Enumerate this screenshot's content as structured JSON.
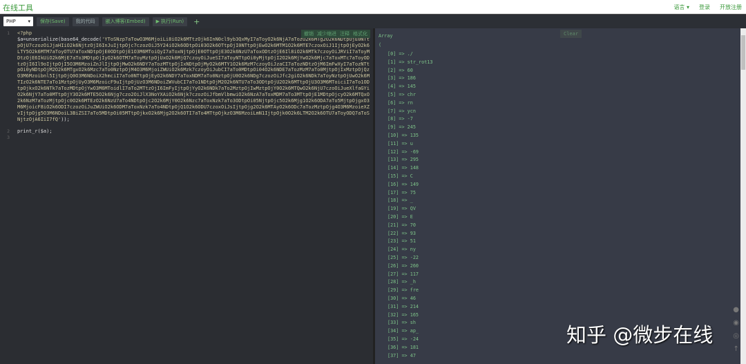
{
  "header": {
    "brand": "在线工具",
    "nav": [
      "语言 ▾",
      "登录",
      "开放注册"
    ]
  },
  "toolbar": {
    "language": "PHP",
    "save": "保存(Save)",
    "my_code": "我的代码",
    "embed": "嵌入博客(Embed)",
    "run": "▶ 执行(Run)",
    "add": "+"
  },
  "editor": {
    "tools": [
      "撤销",
      "减少缩进",
      "注释",
      "格式化"
    ],
    "line_numbers": [
      "1",
      "2",
      "3"
    ],
    "line1": "<?php",
    "code_prefix": "$a=unserialize(base64_decode(",
    "base64": "'YToSNzp7aTowO3M6MjoiLi8iO2k6MTtzOjk6InN0cl9yb3QxMyI7aToyO2k6NjA7aTozO2k6MTg2O2k6NDtpOjE0NTtpOjU7czozOiJjaHIiO2k6NjtzOjI6InJuIjtpOjc7czozOiJ5Y24iO2k6ODtpOi03O2k6OTtpOjI0NTtpOjEwO2k6MTM1O2k6MTE7czoxOiJ1IjtpOjEyO2k6LTY5O2k6MTM7aToyOTU7aToxNDtpOjE0ODtpOjE1O3M6MToiQyI7aToxNjtpOjE0OTtpOjE3O2k6NzU7aToxODtzOjE6Il8iO2k6MTk7czoyOiJRViI7aToyMDtzOjE6IkUiO2k6MjE7aTo3MDtpOjIyO2k6OTM7aToyMztpOjUxO2k6MjQ7czoyOiJueSI7aToyNTtpOi0yMjtpOjI2O2k6MjYwO2k6Mjc7aToxMTc7aToyODtzOjI6Il9oIjtpOjI5O3M6MzoiZnJlIjtpOjMwO2k6NDY7aTozMTtpOjIxNDtpOjMyO2k6MTY1O2k6MzM7czoyOiJzaCI7aTozNDtzOjM6ImFwXyI7aTozNTtpOi0yNDtpOjM2O2k6MTgxO2k6Mzc7aTo0NztpOjM4O3M6MjoiZWUiO2k6Mzk7czoyOiJubCI7aTo0MDtpOi04O2k6NDE7aTozMzM7aTo0MjtpOjIxMztpOjQzO3M6Mzoibnl5IjtpOjQ0O3M6NDoiX2hmciI7aTo0NTtpOjEyO2k6NDY7aToxNDM7aTo0NztpOjU0O2k6NDg7czozOiJfc2giO2k6NDk7aToyNztpOjUwO2k6MTIzO2k6NTE7aTo1MztpOjUyO3M6MzoicF9uIjtpOjUzO3M6NDoiZWVubCI7aTo1NDtpOjM2O2k6NTU7aTo3ODtpOjU2O2k6MTtpOjU3O3M6MToiciI7aTo1ODtpOjkxO2k6NTk7aTozMDtpOjYwO3M6MToidlI7aTo2MTtzOjI6ImFyIjtpOjYyO2k6NDk7aTo2MztpOjIwMztpOjY0O2k6MTQwO2k6NjU7czoOiJueXlfaGYiO2k6NjY7aTo0MTtpOjY3O2k6MTE5O2k6Njg7czo2OiJlX3NoYXAiO2k6Njk7czozOiJfbmVlbmwiO2k6NzA7aToxMDM7aTo3MTtpOjE1MDtpOjcyO2k6MTQxO2k6NzM7aTozMjtpOjc0O2k6MTEzO2k6NzU7aTo4NDtpOjc2O2k6MjY0O2k6Nzc7aToxNzk7aTo3ODtpOi05NjtpOjc5O2k6Mjg1O2k6ODA7aTo5MjtpOjgxO3M6MjoicF8iO2k6ODI7czozOiJuZWUiO2k6ODM7aToxNzk7aTo4NDtpOjQ1O2k6ODU7czoxOiJsIjtpOjg2O2k6MTAyO2k6ODc7aTozMztpOjg4O3M6MzoieXZvIjtpOjg5O3M6NDoiL3BiZSI7aTo5MDtpOi05MTtpOjkxO2k6Mjg2O2k6OTI7aTo4MTtpOjkzO3M6MzoiLmN1IjtpOjk0O2k6LTM2O2k6OTU7aToyODQ7aToSNjtzOjA6IiI7fQ'",
    "code_suffix": "));",
    "line3": "print_r($a);"
  },
  "output": {
    "clear": "Clear",
    "header": "Array",
    "open": "(",
    "items": [
      [
        "0",
        "./"
      ],
      [
        "1",
        "str_rot13"
      ],
      [
        "2",
        "60"
      ],
      [
        "3",
        "186"
      ],
      [
        "4",
        "145"
      ],
      [
        "5",
        "chr"
      ],
      [
        "6",
        "rn"
      ],
      [
        "7",
        "ycn"
      ],
      [
        "8",
        "-7"
      ],
      [
        "9",
        "245"
      ],
      [
        "10",
        "135"
      ],
      [
        "11",
        "u"
      ],
      [
        "12",
        "-69"
      ],
      [
        "13",
        "295"
      ],
      [
        "14",
        "148"
      ],
      [
        "15",
        "C"
      ],
      [
        "16",
        "149"
      ],
      [
        "17",
        "75"
      ],
      [
        "18",
        "_"
      ],
      [
        "19",
        "QV"
      ],
      [
        "20",
        "E"
      ],
      [
        "21",
        "70"
      ],
      [
        "22",
        "93"
      ],
      [
        "23",
        "51"
      ],
      [
        "24",
        "ny"
      ],
      [
        "25",
        "-22"
      ],
      [
        "26",
        "260"
      ],
      [
        "27",
        "117"
      ],
      [
        "28",
        "_h"
      ],
      [
        "29",
        "fre"
      ],
      [
        "30",
        "46"
      ],
      [
        "31",
        "214"
      ],
      [
        "32",
        "165"
      ],
      [
        "33",
        "sh"
      ],
      [
        "34",
        "ap_"
      ],
      [
        "35",
        "-24"
      ],
      [
        "36",
        "181"
      ],
      [
        "37",
        "47"
      ]
    ]
  },
  "watermark": "知乎 @微步在线"
}
